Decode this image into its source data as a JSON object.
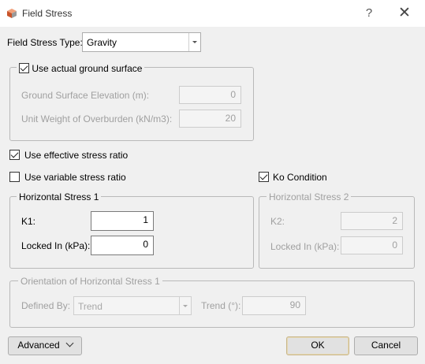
{
  "window": {
    "title": "Field Stress",
    "help": "?",
    "close": "✕"
  },
  "field_stress_type": {
    "label": "Field Stress Type:",
    "value": "Gravity"
  },
  "ground_surface": {
    "checkbox_label": "Use actual ground surface",
    "checked": true,
    "elevation_label": "Ground Surface Elevation (m):",
    "elevation_value": "0",
    "unit_weight_label": "Unit Weight of Overburden (kN/m3):",
    "unit_weight_value": "20"
  },
  "effective_stress": {
    "label": "Use effective stress ratio",
    "checked": true
  },
  "variable_stress": {
    "label": "Use variable stress ratio",
    "checked": false
  },
  "ko_condition": {
    "label": "Ko Condition",
    "checked": true
  },
  "horizontal_stress_1": {
    "title": "Horizontal Stress 1",
    "k_label": "K1:",
    "k_value": "1",
    "locked_label": "Locked In (kPa):",
    "locked_value": "0"
  },
  "horizontal_stress_2": {
    "title": "Horizontal Stress 2",
    "k_label": "K2:",
    "k_value": "2",
    "locked_label": "Locked In (kPa):",
    "locked_value": "0"
  },
  "orientation": {
    "title": "Orientation of Horizontal Stress 1",
    "defined_by_label": "Defined By:",
    "defined_by_value": "Trend",
    "trend_label": "Trend (°):",
    "trend_value": "90"
  },
  "buttons": {
    "advanced": "Advanced",
    "ok": "OK",
    "cancel": "Cancel"
  }
}
